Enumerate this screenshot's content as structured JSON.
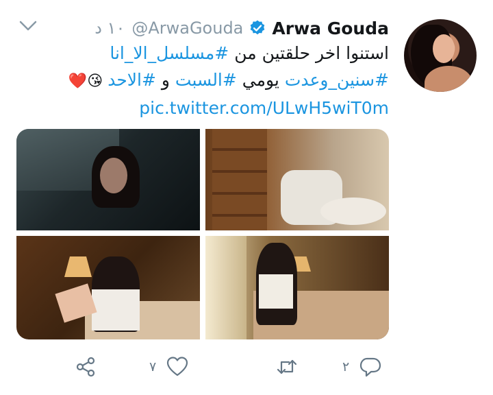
{
  "tweet": {
    "author_name": "Arwa Gouda",
    "handle": "@ArwaGouda",
    "time": "١٠ د",
    "verified": true,
    "text_segments": [
      {
        "type": "text",
        "value": "استنوا اخر حلقتين من "
      },
      {
        "type": "hashtag",
        "value": "#مسلسل_الا_انا"
      }
    ],
    "line2_segments": [
      {
        "type": "hashtag",
        "value": "#سنين_وعدت"
      },
      {
        "type": "text",
        "value": " يومي "
      },
      {
        "type": "hashtag",
        "value": "#السبت"
      },
      {
        "type": "text",
        "value": " و "
      },
      {
        "type": "hashtag",
        "value": "#الاحد"
      },
      {
        "type": "text",
        "value": " 😘❤️"
      }
    ],
    "link": "pic.twitter.com/ULwH5wiT0m"
  },
  "actions": {
    "reply_count": "٢",
    "retweet_count": "",
    "like_count": "٧"
  },
  "icons": {
    "menu": "chevron-down-icon",
    "verified": "verified-badge-icon",
    "reply": "reply-icon",
    "retweet": "retweet-icon",
    "like": "heart-icon",
    "share": "share-icon"
  },
  "colors": {
    "accent": "#1b95e0",
    "muted": "#8899a6",
    "text": "#14171a"
  }
}
